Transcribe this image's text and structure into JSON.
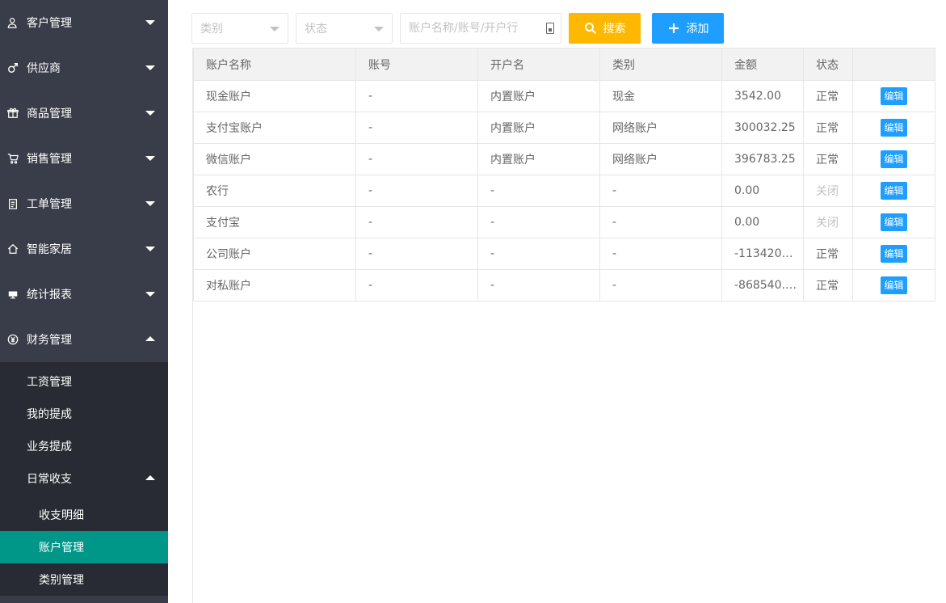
{
  "sidebar": {
    "menu": [
      {
        "label": "客户管理",
        "icon": "user-icon"
      },
      {
        "label": "供应商",
        "icon": "male-icon"
      },
      {
        "label": "商品管理",
        "icon": "gift-icon"
      },
      {
        "label": "销售管理",
        "icon": "cart-icon"
      },
      {
        "label": "工单管理",
        "icon": "clipboard-icon"
      },
      {
        "label": "智能家居",
        "icon": "home-icon"
      },
      {
        "label": "统计报表",
        "icon": "monitor-icon"
      },
      {
        "label": "财务管理",
        "icon": "yen-icon"
      }
    ],
    "finance_sub": [
      "工资管理",
      "我的提成",
      "业务提成",
      "日常收支"
    ],
    "daily_sub": [
      "收支明细",
      "账户管理",
      "类别管理"
    ]
  },
  "toolbar": {
    "category_placeholder": "类别",
    "status_placeholder": "状态",
    "search_placeholder": "账户名称/账号/开户行",
    "search_label": "搜索",
    "add_label": "添加"
  },
  "table": {
    "headers": [
      "账户名称",
      "账号",
      "开户名",
      "类别",
      "金额",
      "状态",
      ""
    ],
    "edit_label": "编辑",
    "rows": [
      {
        "name": "现金账户",
        "account": "-",
        "holder": "内置账户",
        "category": "现金",
        "amount": "3542.00",
        "status": "正常"
      },
      {
        "name": "支付宝账户",
        "account": "-",
        "holder": "内置账户",
        "category": "网络账户",
        "amount": "300032.25",
        "status": "正常"
      },
      {
        "name": "微信账户",
        "account": "-",
        "holder": "内置账户",
        "category": "网络账户",
        "amount": "396783.25",
        "status": "正常"
      },
      {
        "name": "农行",
        "account": "-",
        "holder": "-",
        "category": "-",
        "amount": "0.00",
        "status": "关闭"
      },
      {
        "name": "支付宝",
        "account": "-",
        "holder": "-",
        "category": "-",
        "amount": "0.00",
        "status": "关闭"
      },
      {
        "name": "公司账户",
        "account": "-",
        "holder": "-",
        "category": "-",
        "amount": "-113420…",
        "status": "正常"
      },
      {
        "name": "对私账户",
        "account": "-",
        "holder": "-",
        "category": "-",
        "amount": "-868540.…",
        "status": "正常"
      }
    ]
  },
  "colors": {
    "sidebar_bg": "#393d49",
    "submenu_bg": "#282b33",
    "active": "#009688",
    "search_btn": "#ffb800",
    "add_btn": "#1e9fff"
  }
}
